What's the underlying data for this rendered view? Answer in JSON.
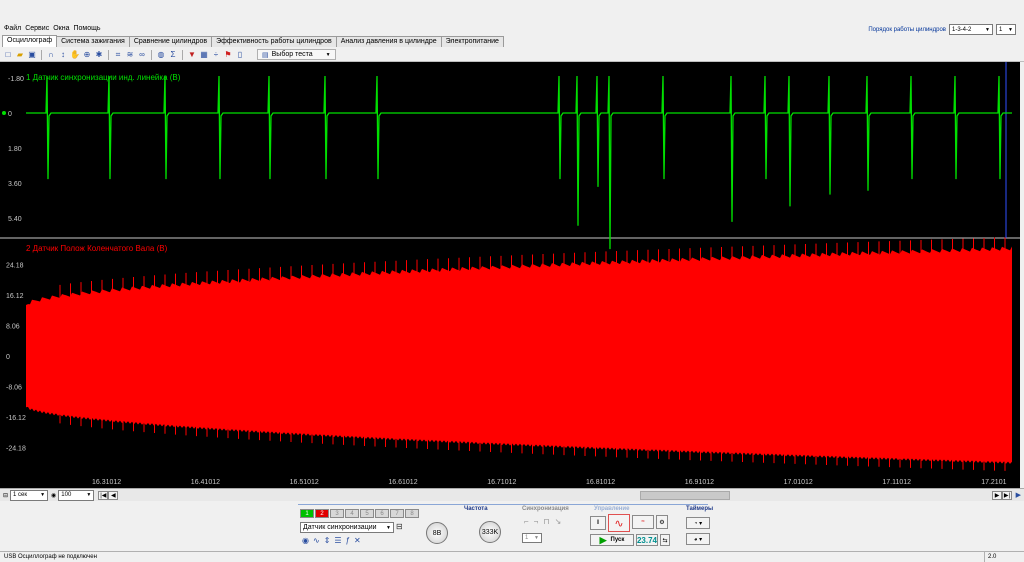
{
  "menu": [
    "Файл",
    "Сервис",
    "Окна",
    "Помощь"
  ],
  "cylinder_order": {
    "label": "Порядок работы цилиндров",
    "value": "1-3-4-2",
    "count": "1"
  },
  "tabs": [
    "Осциллограф",
    "Система зажигания",
    "Сравнение цилиндров",
    "Эффективность работы цилиндров",
    "Анализ давления в цилиндре",
    "Электропитание"
  ],
  "active_tab": 0,
  "toolbar": {
    "test_select_label": "Выбор теста"
  },
  "channel1": {
    "label": "1 Датчик синхронизации инд. линейка (В)",
    "color": "#00e000",
    "ticks": [
      "-1.80",
      "0",
      "1.80",
      "3.60",
      "5.40"
    ],
    "range": [
      -1.8,
      5.4
    ]
  },
  "channel2": {
    "label": "2 Датчик Полож Коленчатого Вала (В)",
    "color": "#ff0000",
    "ticks": [
      "24.18",
      "16.12",
      "8.06",
      "0",
      "-8.06",
      "-16.12",
      "-24.18"
    ],
    "range": [
      -30.2,
      30.2
    ]
  },
  "time_axis": [
    "16.31012",
    "16.41012",
    "16.51012",
    "16.61012",
    "16.71012",
    "16.81012",
    "16.91012",
    "17.01012",
    "17.11012",
    "17.2101"
  ],
  "hscroll": {
    "time_div": "1 сек",
    "zoom": "100"
  },
  "bottom": {
    "channel_buttons": [
      "1",
      "2",
      "3",
      "4",
      "5",
      "6",
      "7",
      "8"
    ],
    "sensor_select": "Датчик синхронизации",
    "voltage_label": "8В",
    "freq_title": "Частота",
    "freq_value": "333K",
    "sync_title": "Синхронизация",
    "sync_value": "1",
    "control_title": "Управление",
    "start_label": "Пуск",
    "counter": "23.74",
    "timers_title": "Таймеры"
  },
  "status": {
    "text": "USB Осциллограф не подключен",
    "version": "2.0"
  }
}
